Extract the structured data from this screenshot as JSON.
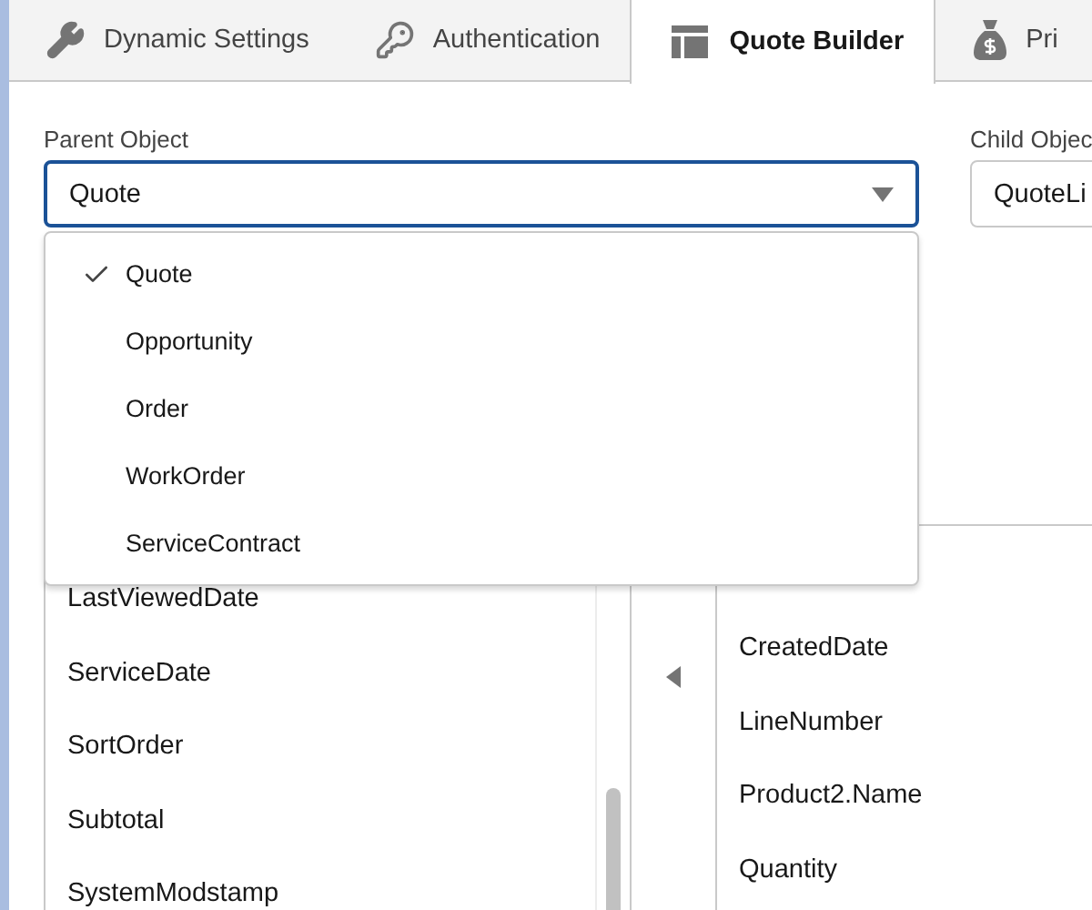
{
  "tabs": [
    {
      "label": "Dynamic Settings",
      "selected": false
    },
    {
      "label": "Authentication",
      "selected": false
    },
    {
      "label": "Quote Builder",
      "selected": true
    },
    {
      "label": "Pri",
      "selected": false
    }
  ],
  "parent_object": {
    "label": "Parent Object",
    "value": "Quote",
    "expanded": true,
    "options": [
      {
        "label": "Quote",
        "selected": true
      },
      {
        "label": "Opportunity",
        "selected": false
      },
      {
        "label": "Order",
        "selected": false
      },
      {
        "label": "WorkOrder",
        "selected": false
      },
      {
        "label": "ServiceContract",
        "selected": false
      }
    ]
  },
  "child_object": {
    "label": "Child Objec",
    "value": "QuoteLi"
  },
  "available_fields": [
    "LastViewedDate",
    "ServiceDate",
    "SortOrder",
    "Subtotal",
    "SystemModstamp"
  ],
  "selected_fields": [
    "CreatedDate",
    "LineNumber",
    "Product2.Name",
    "Quantity"
  ]
}
